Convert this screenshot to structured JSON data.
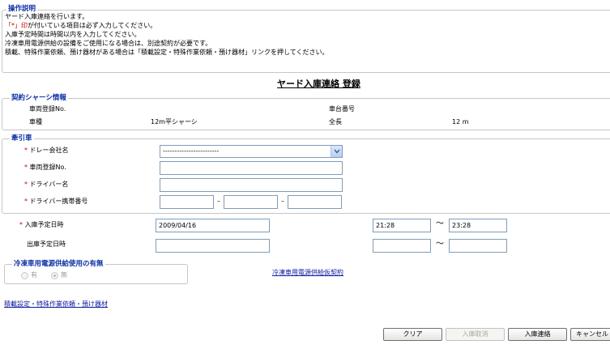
{
  "instructions": {
    "legend": "操作説明",
    "lines": [
      "ヤード入庫連絡を行います。",
      "が付いている項目は必ず入力してください。",
      "入庫予定時間は時間以内を入力してください。",
      "冷凍車用電源供給の設備をご使用になる場合は、別途契約が必要です。",
      "積載、特殊作業依頼、預け器材がある場合は「積載設定・特殊作業依頼・預け器材」リンクを押してください。"
    ],
    "required_marker": "「*」印"
  },
  "page_title": "ヤード入庫連絡 登録",
  "contract_chassis": {
    "legend": "契約シャーシ情報",
    "vehicle_reg_label": "車両登録No.",
    "vehicle_reg_value": "",
    "chassis_no_label": "車台番号",
    "chassis_no_value": "",
    "vehicle_type_label": "車種",
    "vehicle_type_value": "12m平シャーシ",
    "length_label": "全長",
    "length_value": "12 m"
  },
  "tractor": {
    "legend": "牽引車",
    "required_mark": "*",
    "dray_company_label": "ドレー会社名",
    "dray_company_value": "------------------------",
    "vehicle_reg_label": "車両登録No.",
    "driver_name_label": "ドライバー名",
    "driver_phone_label": "ドライバー携帯番号",
    "dash": "–"
  },
  "schedule": {
    "required_mark": "*",
    "arrival_label": "入庫予定日時",
    "arrival_date": "2009/04/16",
    "arrival_time_from": "21:28",
    "tilde": "～",
    "arrival_time_to": "23:28",
    "departure_label": "出庫予定日時",
    "departure_date": "",
    "departure_time_from": "",
    "departure_time_to": ""
  },
  "reefer": {
    "legend": "冷凍車用電源供給使用の有無",
    "option_yes": "有",
    "option_no": "無",
    "selected": "無",
    "contract_link": "冷凍車用電源供給仮契約"
  },
  "links": {
    "loading_settings": "積載設定・特殊作業依頼・預け器材"
  },
  "buttons": {
    "clear": "クリア",
    "cancel_arrival": "入庫取消",
    "arrival_notice": "入庫連絡",
    "cancel": "キャンセル"
  },
  "colors": {
    "legend_text": "#0b2fa5",
    "required": "#d40000",
    "link": "#0c1b9e",
    "input_border": "#7f9db9"
  }
}
